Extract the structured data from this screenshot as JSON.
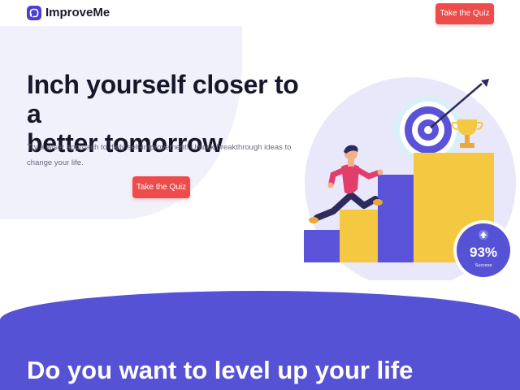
{
  "brand": {
    "name": "ImproveMe"
  },
  "header": {
    "cta_label": "Take the Quiz"
  },
  "hero": {
    "title_line1": "Inch yourself closer to a",
    "title_line2": "better tomorrow",
    "subtitle": "Try a wiser approach to daily self-improvement! Unlock breakthrough ideas to change your life.",
    "cta_label": "Take the Quiz"
  },
  "badge": {
    "value": "93%",
    "label": "Success"
  },
  "section": {
    "title": "Do you want to level up your life"
  },
  "colors": {
    "accent": "#ee4b4b",
    "brand": "#4b3fcf",
    "section_bg": "#5552d6",
    "bar_yellow": "#f5c842",
    "bar_purple": "#5a52d8"
  },
  "icons": {
    "logo": "brand-logo-icon",
    "badge": "arrow-up-icon",
    "target": "target-icon",
    "trophy": "trophy-icon"
  }
}
